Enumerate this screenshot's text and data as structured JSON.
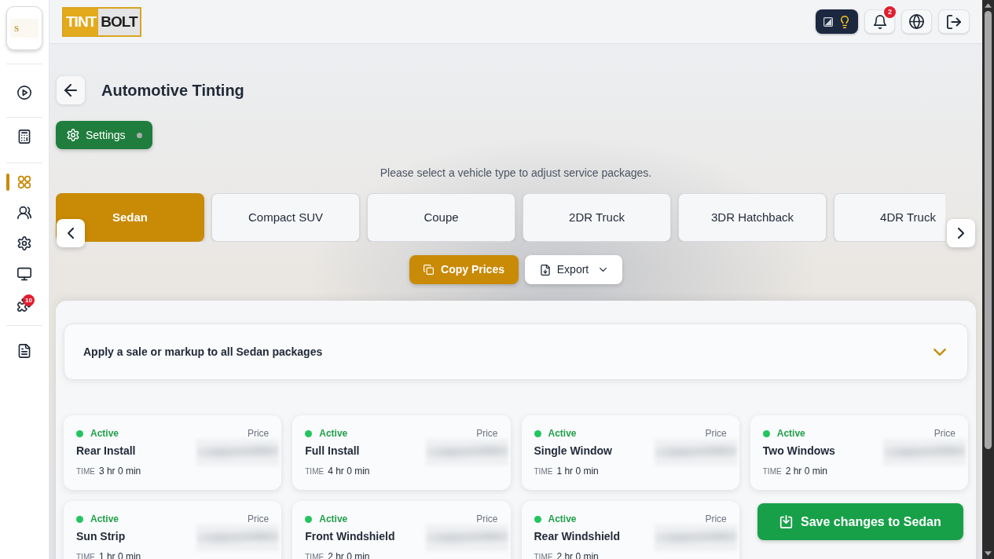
{
  "sidebar": {
    "logo": {
      "mark": "S"
    },
    "groups": [
      {
        "items": [
          {
            "selected": false
          }
        ]
      },
      {
        "items": [
          {
            "selected": false
          }
        ]
      },
      {
        "items": [
          {
            "selected": true
          },
          {
            "selected": false
          },
          {
            "selected": false
          },
          {
            "selected": false
          },
          {
            "selected": false,
            "badge": "10"
          }
        ]
      },
      {
        "items": [
          {
            "selected": false
          }
        ]
      }
    ]
  },
  "header": {
    "logo": {
      "part_1": "TINT",
      "part_2": "BOLT"
    },
    "theme_options": [
      {
        "selected": false
      },
      {
        "selected": true
      }
    ],
    "notifications": {
      "badge": "2"
    }
  },
  "page": {
    "title": "Automotive Tinting",
    "settings_button": "Settings",
    "instruction": "Please select a vehicle type to adjust service packages."
  },
  "vehicle_tabs": [
    {
      "label": "Sedan",
      "selected": true
    },
    {
      "label": "Compact SUV",
      "selected": false
    },
    {
      "label": "Coupe",
      "selected": false
    },
    {
      "label": "2DR Truck",
      "selected": false
    },
    {
      "label": "3DR Hatchback",
      "selected": false
    },
    {
      "label": "4DR Truck",
      "selected": false
    }
  ],
  "actions": {
    "copy_prices": "Copy Prices",
    "export": "Export"
  },
  "bulk_adjust": {
    "label": "Apply a sale or markup to all Sedan packages",
    "expanded": false
  },
  "packages": [
    {
      "status": "Active",
      "active": true,
      "name": "Rear Install",
      "price_label": "Price",
      "time_label": "TIME",
      "time": "3 hr 0 min"
    },
    {
      "status": "Active",
      "active": true,
      "name": "Full Install",
      "price_label": "Price",
      "time_label": "TIME",
      "time": "4 hr 0 min"
    },
    {
      "status": "Active",
      "active": true,
      "name": "Single Window",
      "price_label": "Price",
      "time_label": "TIME",
      "time": "1 hr 0 min"
    },
    {
      "status": "Active",
      "active": true,
      "name": "Two Windows",
      "price_label": "Price",
      "time_label": "TIME",
      "time": "2 hr 0 min"
    },
    {
      "status": "Active",
      "active": true,
      "name": "Sun Strip",
      "price_label": "Price",
      "time_label": "TIME",
      "time": "1 hr 0 min"
    },
    {
      "status": "Active",
      "active": true,
      "name": "Front Windshield",
      "price_label": "Price",
      "time_label": "TIME",
      "time": "2 hr 0 min"
    },
    {
      "status": "Active",
      "active": true,
      "name": "Rear Windshield",
      "price_label": "Price",
      "time_label": "TIME",
      "time": "2 hr 0 min"
    }
  ],
  "save_button": "Save changes to Sedan"
}
